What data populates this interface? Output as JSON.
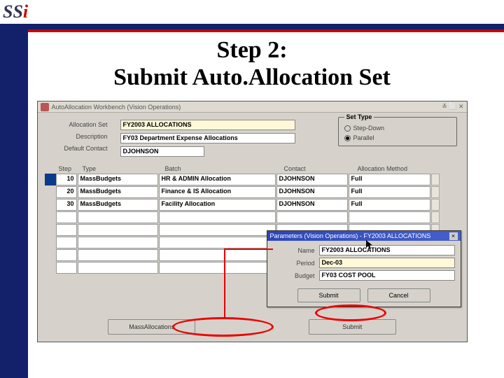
{
  "logo": {
    "s": "SS",
    "i": "i"
  },
  "title_l1": "Step 2:",
  "title_l2": "Submit Auto.Allocation Set",
  "window_title": "AutoAllocation Workbench (Vision Operations)",
  "form": {
    "labels": {
      "set": "Allocation Set",
      "desc": "Description",
      "contact": "Default Contact"
    },
    "values": {
      "set": "FY2003 ALLOCATIONS",
      "desc": "FY03 Department Expense Allocations",
      "contact": "DJOHNSON"
    }
  },
  "settype": {
    "legend": "Set Type",
    "opt1": "Step-Down",
    "opt2": "Parallel"
  },
  "grid": {
    "headers": {
      "step": "Step",
      "type": "Type",
      "batch": "Batch",
      "contact": "Contact",
      "am": "Allocation Method"
    },
    "rows": [
      {
        "step": "10",
        "type": "MassBudgets",
        "batch": "HR & ADMIN Allocation",
        "contact": "DJOHNSON",
        "am": "Full",
        "active": true
      },
      {
        "step": "20",
        "type": "MassBudgets",
        "batch": "Finance & IS Allocation",
        "contact": "DJOHNSON",
        "am": "Full",
        "active": false
      },
      {
        "step": "30",
        "type": "MassBudgets",
        "batch": "Facility Allocation",
        "contact": "DJOHNSON",
        "am": "Full",
        "active": false
      }
    ]
  },
  "buttons": {
    "ma": "MassAllocations",
    "submit": "Submit"
  },
  "modal": {
    "title": "Parameters (Vision Operations) - FY2003 ALLOCATIONS",
    "labels": {
      "name": "Name",
      "period": "Period",
      "budget": "Budget"
    },
    "values": {
      "name": "FY2003 ALLOCATIONS",
      "period": "Dec-03",
      "budget": "FY03 COST POOL"
    },
    "buttons": {
      "submit": "Submit",
      "cancel": "Cancel"
    }
  }
}
